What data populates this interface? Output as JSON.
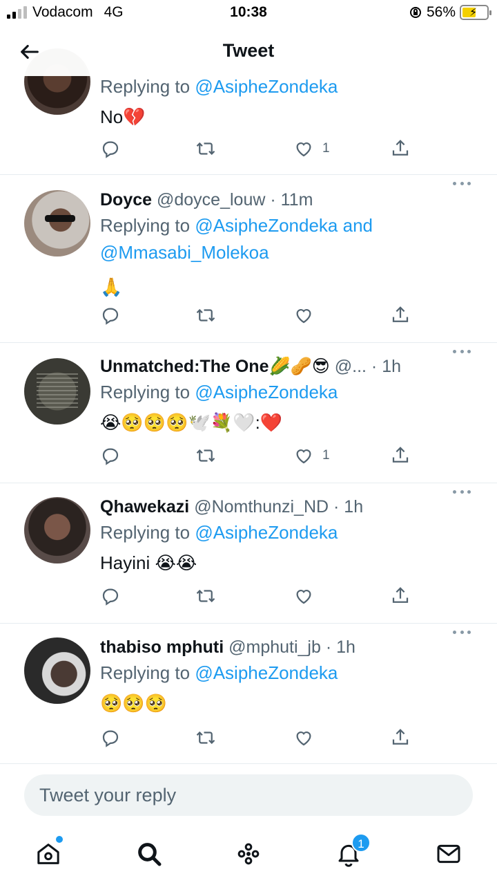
{
  "status": {
    "carrier": "Vodacom",
    "network": "4G",
    "time": "10:38",
    "battery": "56%",
    "battery_level": 0.56
  },
  "header": {
    "title": "Tweet"
  },
  "tweets": [
    {
      "name": "",
      "handle": "",
      "time": "",
      "replying_prefix": "Replying to ",
      "mentions": "@AsipheZondeka",
      "mentions2": "",
      "content": "No💔",
      "likes": "1"
    },
    {
      "name": "Doyce",
      "handle": "@doyce_louw",
      "time": "· 11m",
      "replying_prefix": "Replying to ",
      "mentions": "@AsipheZondeka and",
      "mentions2": "@Mmasabi_Molekoa",
      "content": "🙏",
      "likes": ""
    },
    {
      "name": "Unmatched:The One🌽🥜😎",
      "handle": "@...",
      "time": "· 1h",
      "replying_prefix": "Replying to ",
      "mentions": "@AsipheZondeka",
      "mentions2": "",
      "content": "😭🥺🥺🥺🕊️💐🤍:❤️",
      "likes": "1"
    },
    {
      "name": "Qhawekazi",
      "handle": "@Nomthunzi_ND",
      "time": "· 1h",
      "replying_prefix": "Replying to ",
      "mentions": "@AsipheZondeka",
      "mentions2": "",
      "content": "Hayini 😭😭",
      "likes": ""
    },
    {
      "name": "thabiso mphuti",
      "handle": "@mphuti_jb",
      "time": "· 1h",
      "replying_prefix": "Replying to ",
      "mentions": "@AsipheZondeka",
      "mentions2": "",
      "content": "🥺🥺🥺",
      "likes": ""
    }
  ],
  "compose": {
    "placeholder": "Tweet your reply"
  },
  "nav": {
    "notifications_badge": "1"
  },
  "icons": {
    "back": "arrow-left-icon",
    "reply": "reply-icon",
    "retweet": "retweet-icon",
    "like": "heart-icon",
    "share": "share-icon",
    "more": "more-icon",
    "home": "home-icon",
    "search": "search-icon",
    "spaces": "spaces-icon",
    "notifications": "bell-icon",
    "messages": "mail-icon"
  },
  "colors": {
    "accent": "#1d9bf0",
    "muted": "#536471",
    "text": "#0f1419"
  }
}
